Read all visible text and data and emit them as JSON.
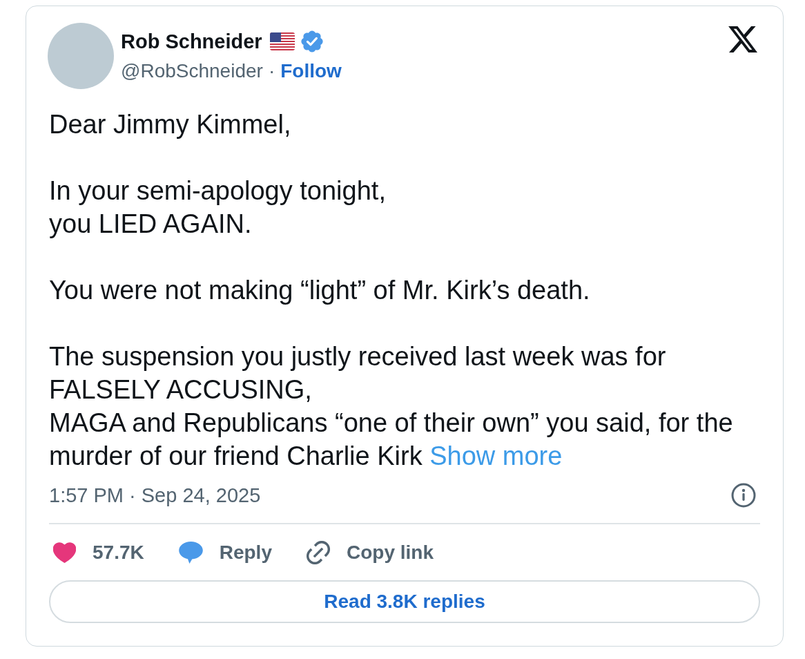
{
  "author": {
    "name": "Rob Schneider",
    "verified": true,
    "handle": "@RobSchneider",
    "separator": "·",
    "follow": "Follow"
  },
  "tweet": {
    "paragraphs": [
      {
        "lines": [
          "Dear Jimmy Kimmel,"
        ]
      },
      {
        "lines": [
          "In your semi-apology tonight,",
          "you LIED AGAIN."
        ]
      },
      {
        "lines": [
          "You were not making “light” of Mr. Kirk’s death."
        ]
      },
      {
        "lines": [
          "The suspension you justly received last week was for",
          "FALSELY ACCUSING,",
          "MAGA and Republicans “one of their own” you said, for the",
          "murder of our friend Charlie Kirk"
        ]
      }
    ],
    "show_more": "Show more",
    "timestamp": "1:57 PM · Sep 24, 2025"
  },
  "actions": [
    {
      "kind": "like",
      "label": "57.7K"
    },
    {
      "kind": "reply",
      "label": "Reply"
    },
    {
      "kind": "copy_link",
      "label": "Copy link"
    }
  ],
  "read_replies": "Read 3.8K replies"
}
